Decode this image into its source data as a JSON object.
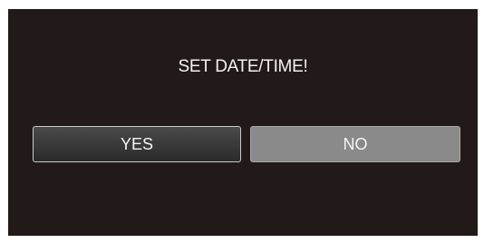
{
  "dialog": {
    "message": "SET DATE/TIME!",
    "yes_label": "YES",
    "no_label": "NO",
    "selected": "YES"
  },
  "colors": {
    "background": "#221a18",
    "selected_button": "#3a3a3a",
    "unselected_button": "#8a8a8a",
    "text": "#f2f2f2"
  }
}
